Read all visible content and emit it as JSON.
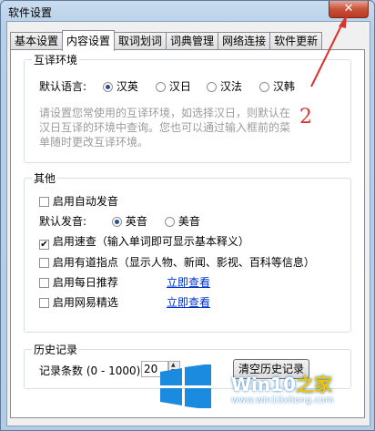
{
  "window": {
    "title": "软件设置",
    "close_label": "✕"
  },
  "tabs": [
    {
      "label": "基本设置",
      "active": false
    },
    {
      "label": "内容设置",
      "active": true
    },
    {
      "label": "取词划词",
      "active": false
    },
    {
      "label": "词典管理",
      "active": false
    },
    {
      "label": "网络连接",
      "active": false
    },
    {
      "label": "软件更新",
      "active": false
    }
  ],
  "mutual_translation": {
    "group_title": "互译环境",
    "default_language_label": "默认语言:",
    "options": [
      "汉英",
      "汉日",
      "汉法",
      "汉韩"
    ],
    "selected": "汉英",
    "hint_lines": [
      "请设置您常使用的互译环境，如选择汉日，则默认在",
      "汉日互译的环境中查询。您也可以通过输入框前的菜",
      "单随时更改互译环境。"
    ]
  },
  "other": {
    "group_title": "其他",
    "auto_pronounce_label": "启用自动发音",
    "auto_pronounce_checked": false,
    "default_pronounce_label": "默认发音:",
    "pronounce_options": [
      "英音",
      "美音"
    ],
    "pronounce_selected": "英音",
    "quick_lookup_label": "启用速查（输入单词即可显示基本释义）",
    "quick_lookup_checked": true,
    "youdao_tips_label": "启用有道指点（显示人物、新闻、影视、百科等信息）",
    "youdao_tips_checked": false,
    "daily_recommend_label": "启用每日推荐",
    "daily_recommend_checked": false,
    "netease_label": "启用网易精选",
    "netease_checked": false,
    "view_now_label": "立即查看"
  },
  "history": {
    "group_title": "历史记录",
    "count_label": "记录条数 (0 - 1000)",
    "count_value": "20",
    "clear_button": "清空历史记录"
  },
  "annotation": {
    "number": "2",
    "color": "#d9342b"
  },
  "watermark": {
    "brand_main": "Win10",
    "brand_accent": "之家",
    "url": "www.win10xitong.com"
  }
}
